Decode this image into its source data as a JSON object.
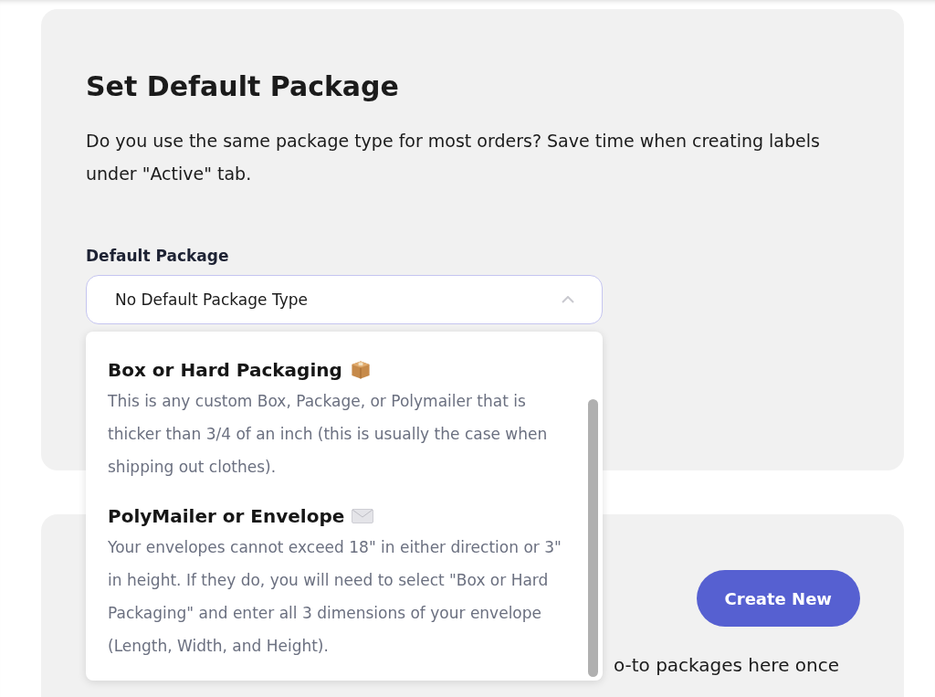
{
  "default_package_card": {
    "title": "Set Default Package",
    "description": "Do you use the same package type for most orders? Save time when creating labels under \"Active\" tab.",
    "field_label": "Default Package",
    "select": {
      "value": "No Default Package Type",
      "expanded": true
    },
    "options": [
      {
        "kind": "box",
        "title": "Box or Hard Packaging",
        "description": "This is any custom Box, Package, or Polymailer that is thicker than 3/4 of an inch (this is usually the case when shipping out clothes)."
      },
      {
        "kind": "envelope",
        "title": "PolyMailer or Envelope",
        "description": "Your envelopes cannot exceed 18\" in either direction or 3\" in height. If they do, you will need to select \"Box or Hard Packaging\" and enter all 3 dimensions of your envelope (Length, Width, and Height)."
      }
    ]
  },
  "packages_card": {
    "button": "Create New",
    "text_fragment": "o-to packages here once"
  }
}
